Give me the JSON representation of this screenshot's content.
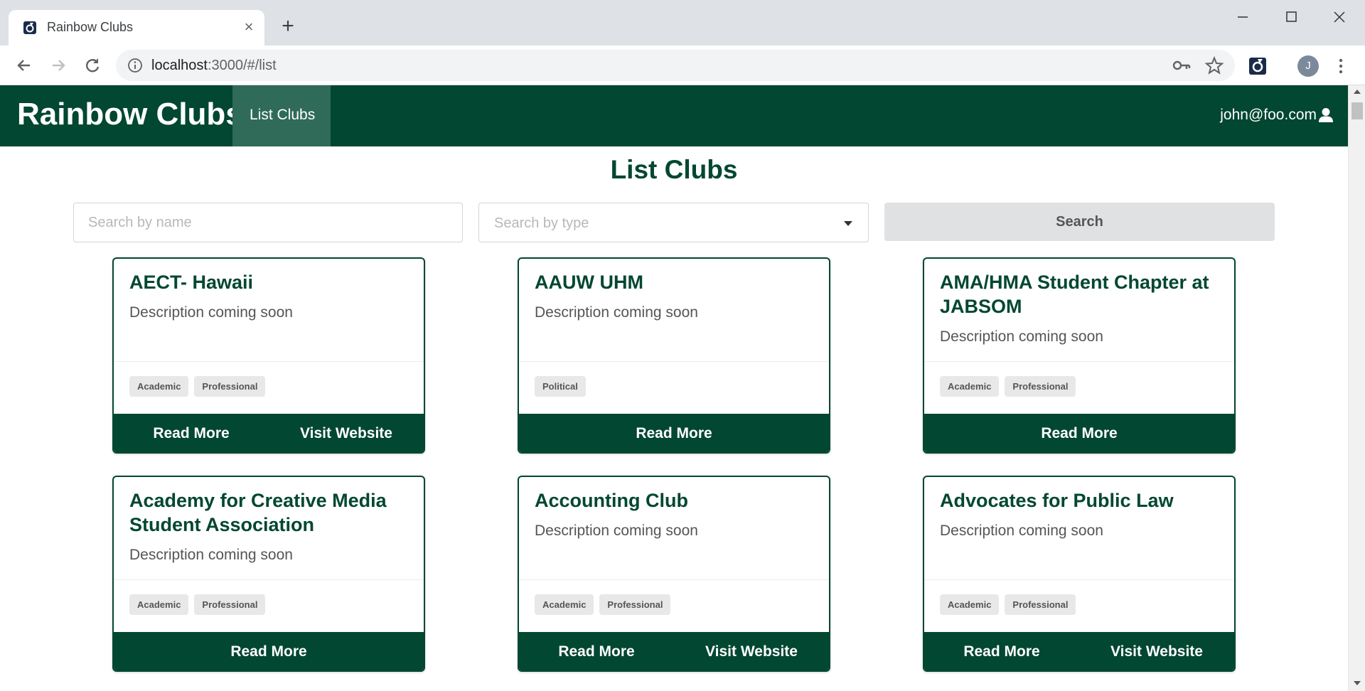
{
  "browser": {
    "tab_title": "Rainbow Clubs",
    "tab_close": "×",
    "new_tab": "+",
    "url_host": "localhost",
    "url_path": ":3000/#/list",
    "profile_initial": "J"
  },
  "nav": {
    "brand": "Rainbow Clubs",
    "active_item": "List Clubs",
    "user": "john@foo.com"
  },
  "page": {
    "title": "List Clubs",
    "search_name_placeholder": "Search by name",
    "search_type_placeholder": "Search by type",
    "search_button": "Search"
  },
  "clubs": [
    {
      "name": "AECT- Hawaii",
      "description": "Description coming soon",
      "tags": [
        "Academic",
        "Professional"
      ],
      "buttons": [
        "Read More",
        "Visit Website"
      ]
    },
    {
      "name": "AAUW UHM",
      "description": "Description coming soon",
      "tags": [
        "Political"
      ],
      "buttons": [
        "Read More"
      ]
    },
    {
      "name": "AMA/HMA Student Chapter at JABSOM",
      "description": "Description coming soon",
      "tags": [
        "Academic",
        "Professional"
      ],
      "buttons": [
        "Read More"
      ]
    },
    {
      "name": "Academy for Creative Media Student Association",
      "description": "Description coming soon",
      "tags": [
        "Academic",
        "Professional"
      ],
      "buttons": [
        "Read More"
      ]
    },
    {
      "name": "Accounting Club",
      "description": "Description coming soon",
      "tags": [
        "Academic",
        "Professional"
      ],
      "buttons": [
        "Read More",
        "Visit Website"
      ]
    },
    {
      "name": "Advocates for Public Law",
      "description": "Description coming soon",
      "tags": [
        "Academic",
        "Professional"
      ],
      "buttons": [
        "Read More",
        "Visit Website"
      ]
    }
  ],
  "colors": {
    "primary": "#024731",
    "nav_active": "#2f6b58",
    "tag_bg": "#e8e8e8",
    "search_button_bg": "#e0e1e2"
  }
}
